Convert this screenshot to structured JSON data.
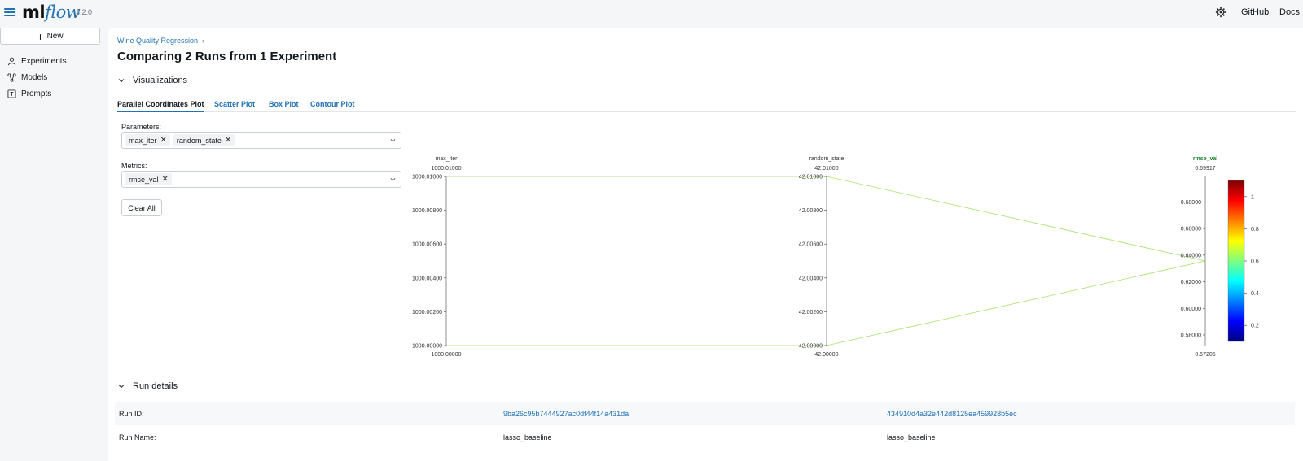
{
  "app": {
    "logo_ml": "ml",
    "logo_flow": "flow",
    "version": "3.2.0"
  },
  "topnav": {
    "github": "GitHub",
    "docs": "Docs",
    "settings_icon": "gear-icon"
  },
  "sidebar": {
    "new_label": "New",
    "items": [
      {
        "label": "Experiments",
        "icon": "user-icon"
      },
      {
        "label": "Models",
        "icon": "models-icon"
      },
      {
        "label": "Prompts",
        "icon": "prompt-icon"
      }
    ]
  },
  "breadcrumb": {
    "experiment": "Wine Quality Regression"
  },
  "page_title": "Comparing 2 Runs from 1 Experiment",
  "visualizations": {
    "title": "Visualizations",
    "tabs": [
      "Parallel Coordinates Plot",
      "Scatter Plot",
      "Box Plot",
      "Contour Plot"
    ],
    "active_tab": 0,
    "parameters_label": "Parameters:",
    "parameters": [
      "max_iter",
      "random_state"
    ],
    "metrics_label": "Metrics:",
    "metrics": [
      "rmse_val"
    ],
    "clear_all": "Clear All"
  },
  "chart_data": {
    "type": "parallel_coordinates",
    "axes": [
      {
        "name": "max_iter",
        "top": "1000.01000",
        "bottom": "1000.00000",
        "ticks": [
          "1000.01000",
          "1000.00800",
          "1000.00600",
          "1000.00400",
          "1000.00200",
          "1000.00000"
        ],
        "range": [
          1000.0,
          1000.01
        ]
      },
      {
        "name": "random_state",
        "top": "42.01000",
        "bottom": "42.00000",
        "ticks": [
          "42.01000",
          "42.00800",
          "42.00600",
          "42.00400",
          "42.00200",
          "42.00000"
        ],
        "range": [
          42.0,
          42.01
        ]
      },
      {
        "name": "rmse_val",
        "top": "0.69917",
        "bottom": "0.57205",
        "ticks": [
          "0.68000",
          "0.66000",
          "0.64000",
          "0.62000",
          "0.60000",
          "0.58000"
        ],
        "range": [
          0.57205,
          0.69917
        ]
      }
    ],
    "runs": [
      {
        "values": [
          1000.01,
          42.01,
          0.6356
        ]
      },
      {
        "values": [
          1000.0,
          42.0,
          0.6356
        ]
      }
    ],
    "line_color": "#a5e06b",
    "colorscale": {
      "ticks": [
        "1",
        "0.8",
        "0.6",
        "0.4",
        "0.2"
      ],
      "range": [
        0.1,
        1.1
      ]
    }
  },
  "run_details": {
    "title": "Run details",
    "rows": [
      {
        "key": "Run ID:",
        "v1": "9ba26c95b7444927ac0df44f14a431da",
        "v2": "434910d4a32e442d8125ea459928b5ec",
        "link": true
      },
      {
        "key": "Run Name:",
        "v1": "lasso_baseline",
        "v2": "lasso_baseline",
        "link": false
      }
    ]
  }
}
